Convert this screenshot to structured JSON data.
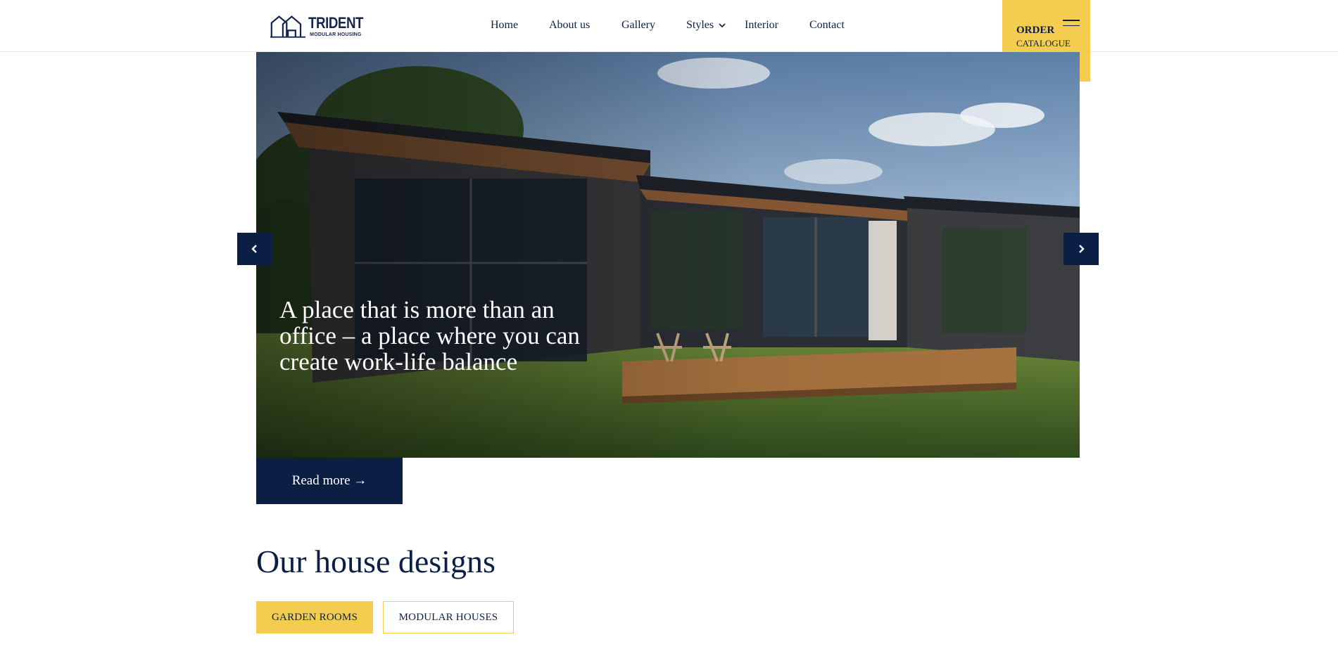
{
  "header": {
    "logo": {
      "name": "TRIDENT",
      "tagline": "MODULAR HOUSING",
      "icon": "house-outline-icon"
    },
    "nav": [
      {
        "label": "Home"
      },
      {
        "label": "About us"
      },
      {
        "label": "Gallery"
      },
      {
        "label": "Styles",
        "has_dropdown": true,
        "icon": "chevron-down-icon"
      },
      {
        "label": "Interior"
      },
      {
        "label": "Contact"
      }
    ],
    "order_button": {
      "title": "ORDER",
      "subtitle": "CATALOGUE",
      "icon": "hamburger-menu-icon"
    }
  },
  "hero": {
    "caption": "A place that is more than an office – a place where you can create work-life balance",
    "prev_icon": "chevron-left-icon",
    "next_icon": "chevron-right-icon",
    "image": "modern-modular-house-photo"
  },
  "read_more": {
    "label": "Read more →"
  },
  "designs": {
    "title": "Our house designs",
    "filters": [
      {
        "label": "GARDEN ROOMS",
        "active": true
      },
      {
        "label": "MODULAR HOUSES",
        "active": false
      }
    ]
  },
  "colors": {
    "navy": "#0b1f45",
    "yellow": "#f3cc50",
    "white": "#ffffff"
  }
}
